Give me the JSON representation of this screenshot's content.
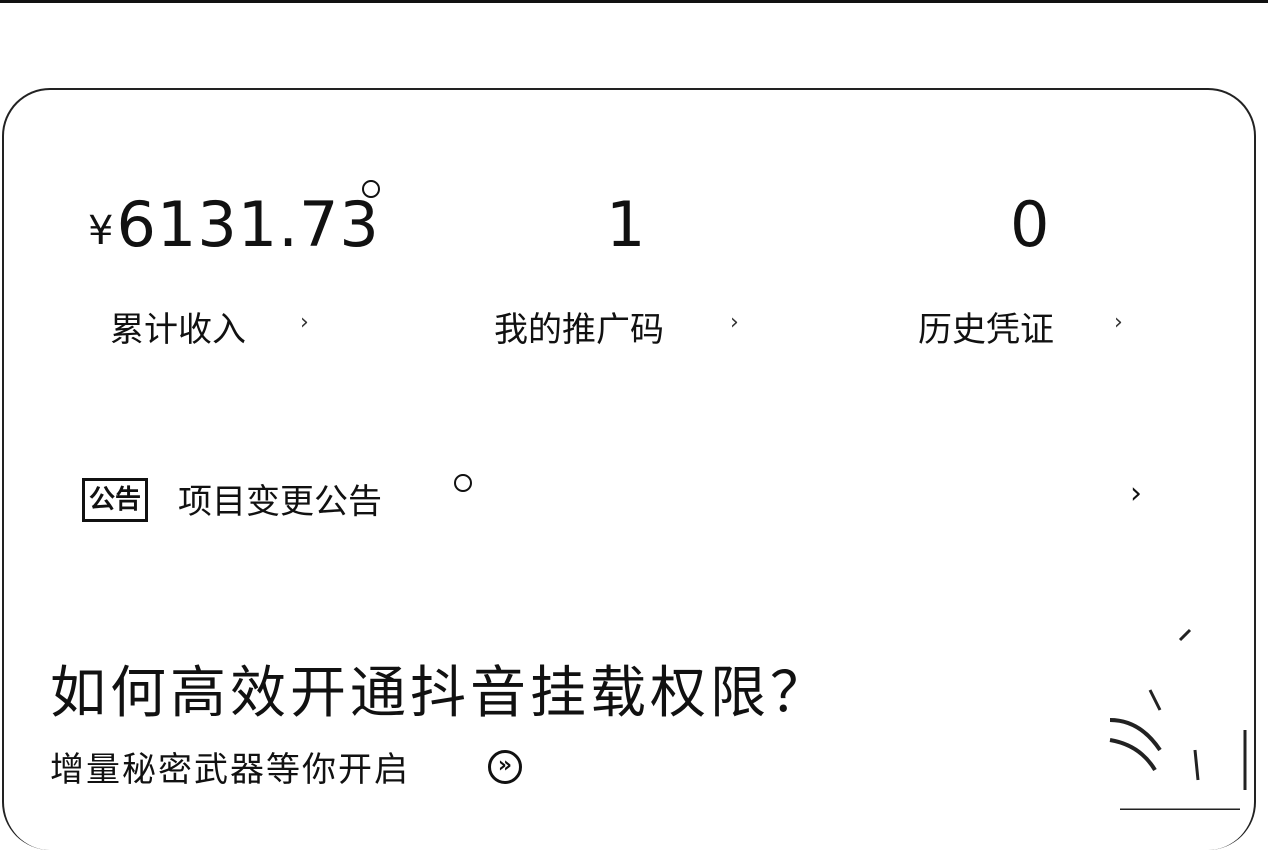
{
  "stats": [
    {
      "currency": "¥",
      "value": "6131.73",
      "label": "累计收入",
      "chevron": "›"
    },
    {
      "value": "1",
      "label": "我的推广码",
      "chevron": "›"
    },
    {
      "value": "0",
      "label": "历史凭证",
      "chevron": "›"
    }
  ],
  "notice": {
    "tag": "公告",
    "text": "项目变更公告",
    "chevron": "›"
  },
  "promo": {
    "title": "如何高效开通抖音挂载权限？",
    "subtitle": "增量秘密武器等你开启",
    "action_icon": "double-chevron-right-icon"
  }
}
